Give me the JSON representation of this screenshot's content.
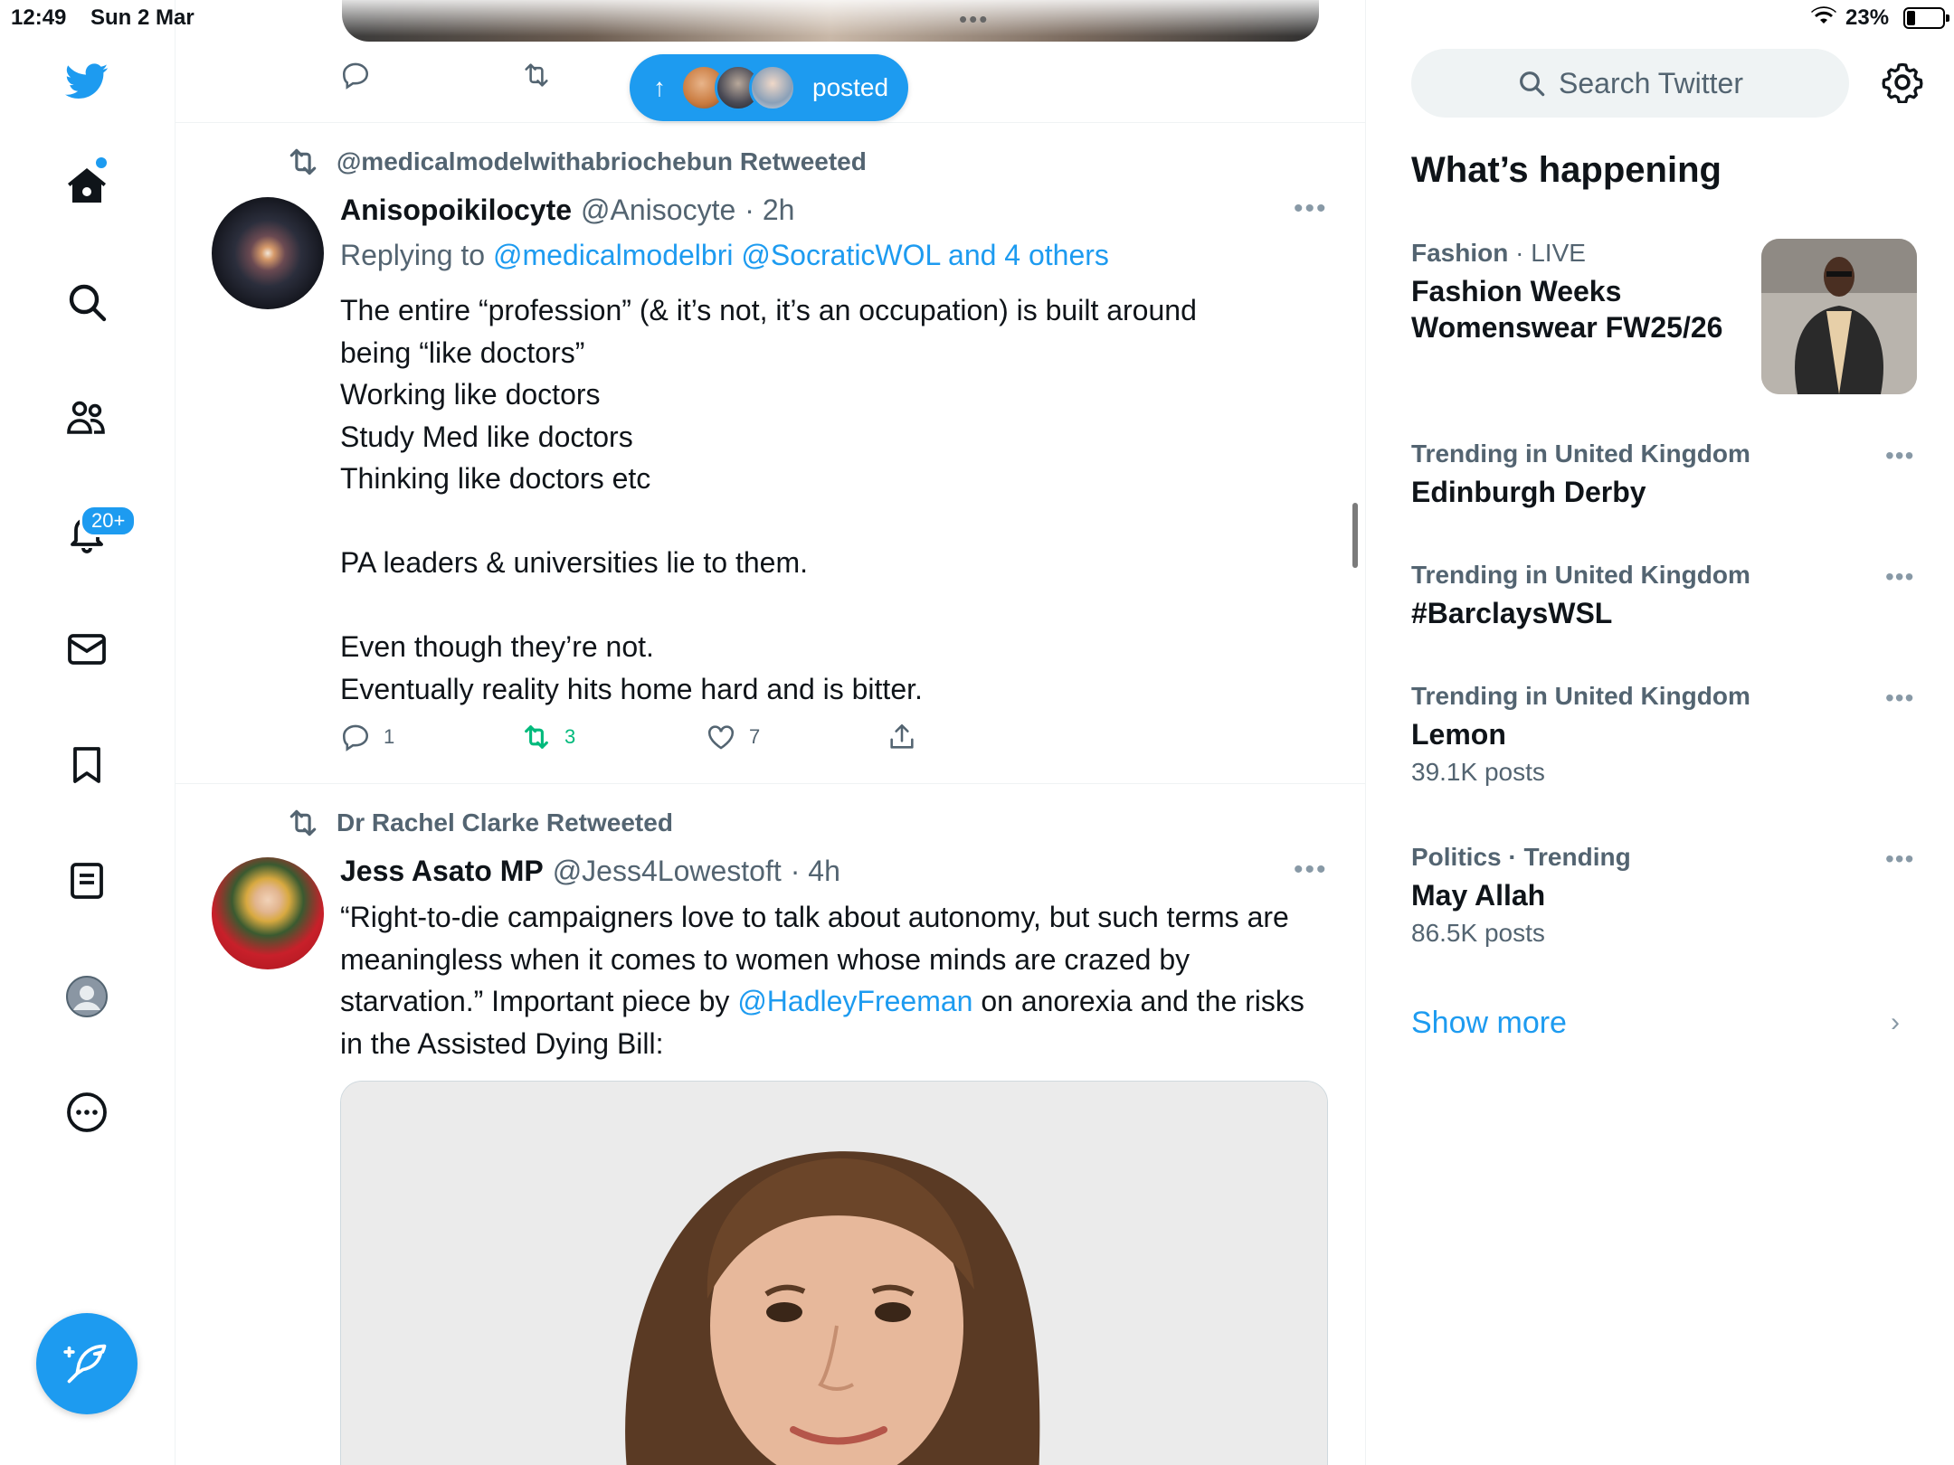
{
  "status_bar": {
    "time": "12:49",
    "date": "Sun 2 Mar",
    "battery": "23%"
  },
  "nav": {
    "notifications_badge": "20+"
  },
  "new_posts_pill": {
    "label": "posted"
  },
  "tweets": [
    {
      "retweeted_by": "@medicalmodelwithabriochebun Retweeted",
      "name": "Anisopoikilocyte",
      "handle": "@Anisocyte",
      "time": "· 2h",
      "reply_prefix": "Replying to ",
      "reply_mentions": "@medicalmodelbri @SocraticWOL and 4 others",
      "lines": [
        "The entire “profession” (& it’s not, it’s an occupation) is built around",
        "being “like doctors”",
        "Working like doctors",
        "Study Med like doctors",
        "Thinking like doctors etc",
        "",
        "PA leaders & universities lie to them.",
        "",
        "Even though they’re not.",
        "Eventually reality hits home hard and is bitter."
      ],
      "replies": "1",
      "retweets": "3",
      "likes": "7"
    },
    {
      "retweeted_by": "Dr Rachel Clarke Retweeted",
      "name": "Jess Asato MP",
      "handle": "@Jess4Lowestoft",
      "time": "· 4h",
      "text_a": "“Right-to-die campaigners love to talk about autonomy, but such terms are meaningless when it comes to women whose minds are crazed by starvation.” Important piece by ",
      "mention": "@HadleyFreeman",
      "text_b": " on anorexia and the risks in the Assisted Dying Bill:"
    }
  ],
  "sidebar": {
    "search_placeholder": "Search Twitter",
    "section_title": "What’s happening",
    "trends": [
      {
        "category": "Fashion",
        "meta": " · LIVE",
        "topic": "Fashion Weeks Womenswear FW25/26",
        "count": ""
      },
      {
        "category": "Trending in United Kingdom",
        "meta": "",
        "topic": "Edinburgh Derby",
        "count": ""
      },
      {
        "category": "Trending in United Kingdom",
        "meta": "",
        "topic": "#BarclaysWSL",
        "count": ""
      },
      {
        "category": "Trending in United Kingdom",
        "meta": "",
        "topic": "Lemon",
        "count": "39.1K posts"
      },
      {
        "category": "Politics · Trending",
        "meta": "",
        "topic": "May Allah",
        "count": "86.5K posts"
      }
    ],
    "show_more": "Show more"
  },
  "colors": {
    "accent": "#1d9bf0",
    "retweet_green": "#00ba7c",
    "muted": "#536471"
  }
}
